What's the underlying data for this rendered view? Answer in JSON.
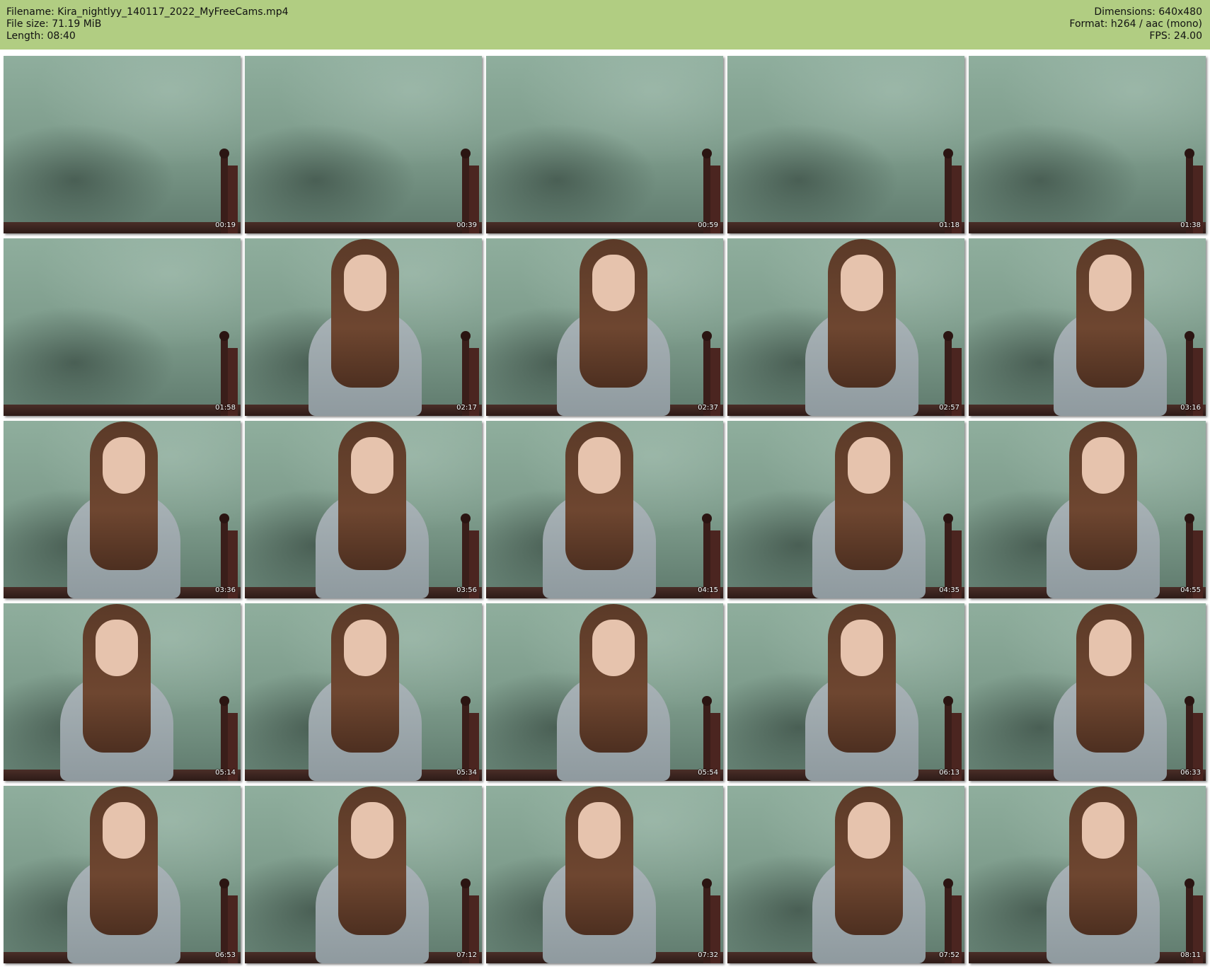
{
  "header": {
    "filename_line": "Filename: Kira_nightlyy_140117_2022_MyFreeCams.mp4",
    "filesize_line": "File size: 71.19 MiB",
    "length_line": "Length: 08:40",
    "dimensions_line": "Dimensions: 640x480",
    "format_line": "Format: h264 / aac (mono)",
    "fps_line": "FPS: 24.00",
    "background_color": "#b1cd82"
  },
  "thumbnails": [
    {
      "time": "00:19",
      "subject": false
    },
    {
      "time": "00:39",
      "subject": false
    },
    {
      "time": "00:59",
      "subject": false
    },
    {
      "time": "01:18",
      "subject": false
    },
    {
      "time": "01:38",
      "subject": false
    },
    {
      "time": "01:58",
      "subject": false
    },
    {
      "time": "02:17",
      "subject": true
    },
    {
      "time": "02:37",
      "subject": true
    },
    {
      "time": "02:57",
      "subject": true
    },
    {
      "time": "03:16",
      "subject": true
    },
    {
      "time": "03:36",
      "subject": true
    },
    {
      "time": "03:56",
      "subject": true
    },
    {
      "time": "04:15",
      "subject": true
    },
    {
      "time": "04:35",
      "subject": true
    },
    {
      "time": "04:55",
      "subject": true
    },
    {
      "time": "05:14",
      "subject": true
    },
    {
      "time": "05:34",
      "subject": true
    },
    {
      "time": "05:54",
      "subject": true
    },
    {
      "time": "06:13",
      "subject": true
    },
    {
      "time": "06:33",
      "subject": true
    },
    {
      "time": "06:53",
      "subject": true
    },
    {
      "time": "07:12",
      "subject": true
    },
    {
      "time": "07:32",
      "subject": true
    },
    {
      "time": "07:52",
      "subject": true
    },
    {
      "time": "08:11",
      "subject": true
    }
  ]
}
